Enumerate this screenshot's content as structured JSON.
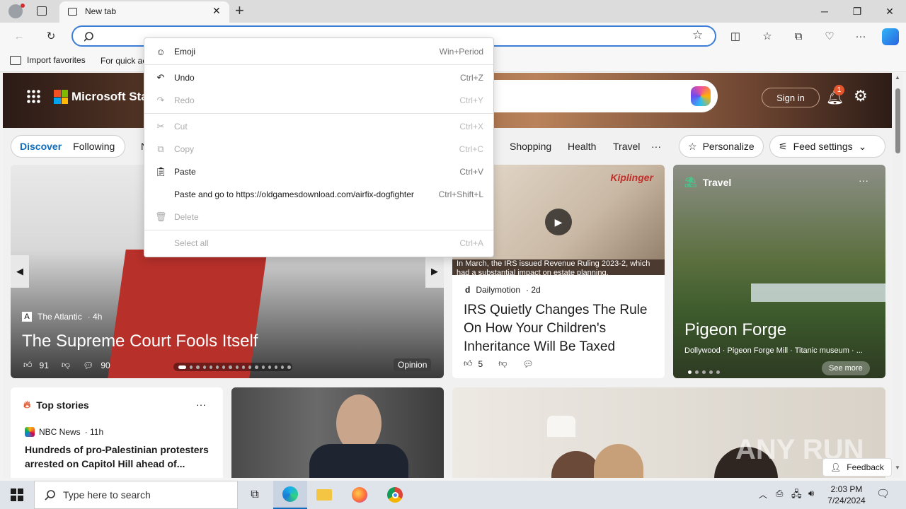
{
  "browser": {
    "tab_title": "New tab",
    "favorites": {
      "import": "Import favorites",
      "quick": "For quick ac"
    }
  },
  "context_menu": {
    "items": [
      {
        "label": "Emoji",
        "shortcut": "Win+Period",
        "disabled": false
      },
      {
        "label": "Undo",
        "shortcut": "Ctrl+Z",
        "disabled": false
      },
      {
        "label": "Redo",
        "shortcut": "Ctrl+Y",
        "disabled": true
      },
      {
        "label": "Cut",
        "shortcut": "Ctrl+X",
        "disabled": true
      },
      {
        "label": "Copy",
        "shortcut": "Ctrl+C",
        "disabled": true
      },
      {
        "label": "Paste",
        "shortcut": "Ctrl+V",
        "disabled": false
      },
      {
        "label": "Paste and go to https://oldgamesdownload.com/airfix-dogfighter",
        "shortcut": "Ctrl+Shift+L",
        "disabled": false
      },
      {
        "label": "Delete",
        "shortcut": "",
        "disabled": true
      },
      {
        "label": "Select all",
        "shortcut": "Ctrl+A",
        "disabled": true
      }
    ]
  },
  "msn": {
    "brand": "Microsoft Star",
    "sign_in": "Sign in",
    "notif_count": "1",
    "nav": {
      "discover": "Discover",
      "following": "Following",
      "partial": "N",
      "shopping": "Shopping",
      "health": "Health",
      "travel": "Travel",
      "more": "···",
      "personalize": "Personalize",
      "feed_settings": "Feed settings"
    },
    "hero": {
      "source": "The Atlantic",
      "age": "· 4h",
      "title": "The Supreme Court Fools Itself",
      "likes": "91",
      "comments": "90",
      "tag": "Opinion"
    },
    "irs": {
      "caption": "In March, the IRS issued Revenue Ruling 2023-2, which had a substantial impact on estate planning.",
      "kiplinger": "Kiplinger",
      "source": "Dailymotion",
      "age": "· 2d",
      "title": "IRS Quietly Changes The Rule On How Your Children's Inheritance Will Be Taxed",
      "likes": "5"
    },
    "travel": {
      "label": "Travel",
      "title": "Pigeon Forge",
      "subtitle": "Dollywood · Pigeon Forge Mill · Titanic museum · ...",
      "see_more": "See more"
    },
    "top_stories": {
      "label": "Top stories",
      "source": "NBC News",
      "age": "· 11h",
      "title": "Hundreds of pro-Palestinian protesters arrested on Capitol Hill ahead of..."
    },
    "feedback": "Feedback",
    "watermark": "ANY RUN"
  },
  "taskbar": {
    "search_placeholder": "Type here to search",
    "time": "2:03 PM",
    "date": "7/24/2024"
  }
}
